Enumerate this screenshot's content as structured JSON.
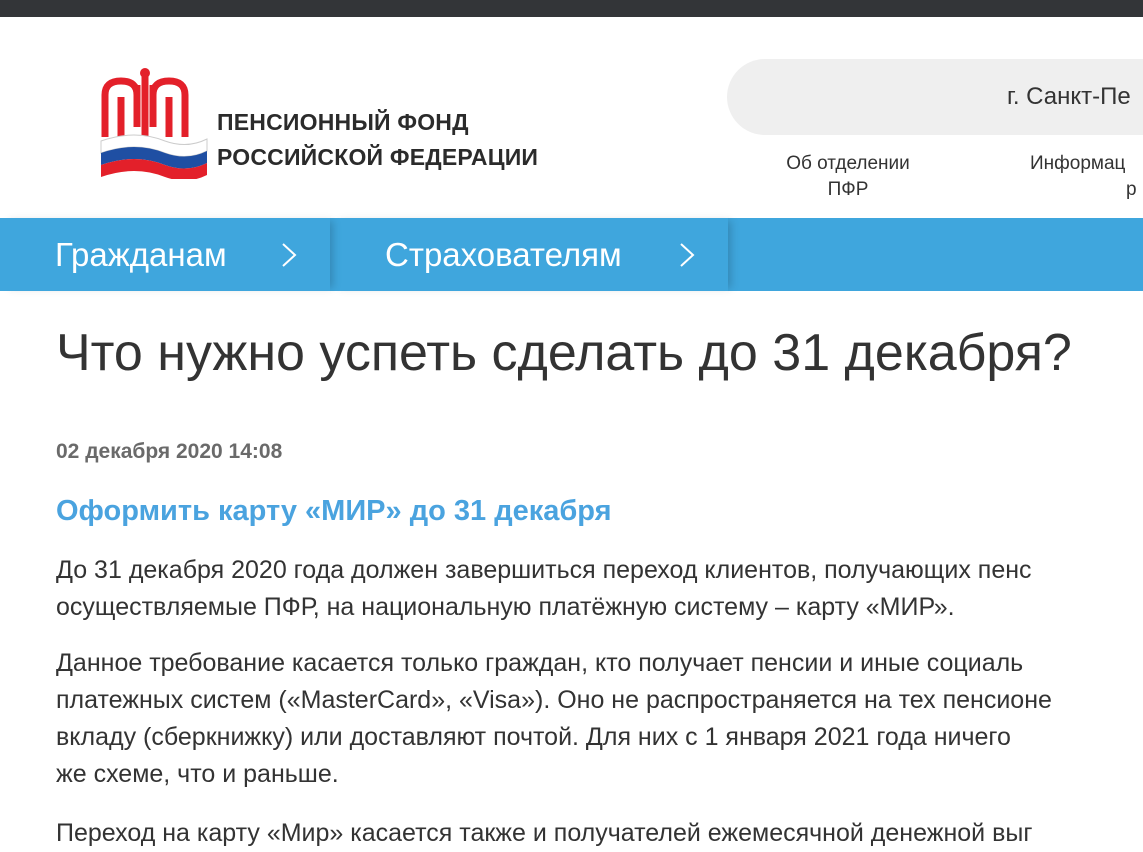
{
  "header": {
    "logo_line1": "ПЕНСИОННЫЙ ФОНД",
    "logo_line2": "РОССИЙСКОЙ ФЕДЕРАЦИИ",
    "region": "г. Санкт-Пе",
    "links": {
      "about_line1": "Об отделении",
      "about_line2": "ПФР",
      "info_line1": "Информац",
      "info_line2": "р"
    }
  },
  "nav": {
    "citizens": "Гражданам",
    "insurers": "Страхователям"
  },
  "article": {
    "title": "Что нужно успеть сделать до 31 декабря?",
    "date": "02 декабря 2020 14:08",
    "subheading": "Оформить карту «МИР» до 31 декабря",
    "p1_lines": [
      "До 31 декабря 2020 года должен завершиться переход клиентов, получающих пенс",
      "осуществляемые ПФР, на национальную платёжную систему – карту «МИР»."
    ],
    "p2_lines": [
      "Данное требование касается только граждан, кто получает пенсии и иные социаль",
      "платежных систем («MasterCard», «Visa»). Оно не распространяется на тех пенсионе",
      "вкладу (сберкнижку) или доставляют почтой. Для них с 1 января 2021 года ничего",
      "же схеме, что и раньше."
    ],
    "p3_lines": [
      "Переход на карту «Мир» касается также и получателей ежемесячной денежной выг"
    ]
  },
  "colors": {
    "nav_bg": "#3fa6dd",
    "subheading": "#4aa3df",
    "logo_red": "#e3202a",
    "flag_blue": "#1f4fa3"
  }
}
